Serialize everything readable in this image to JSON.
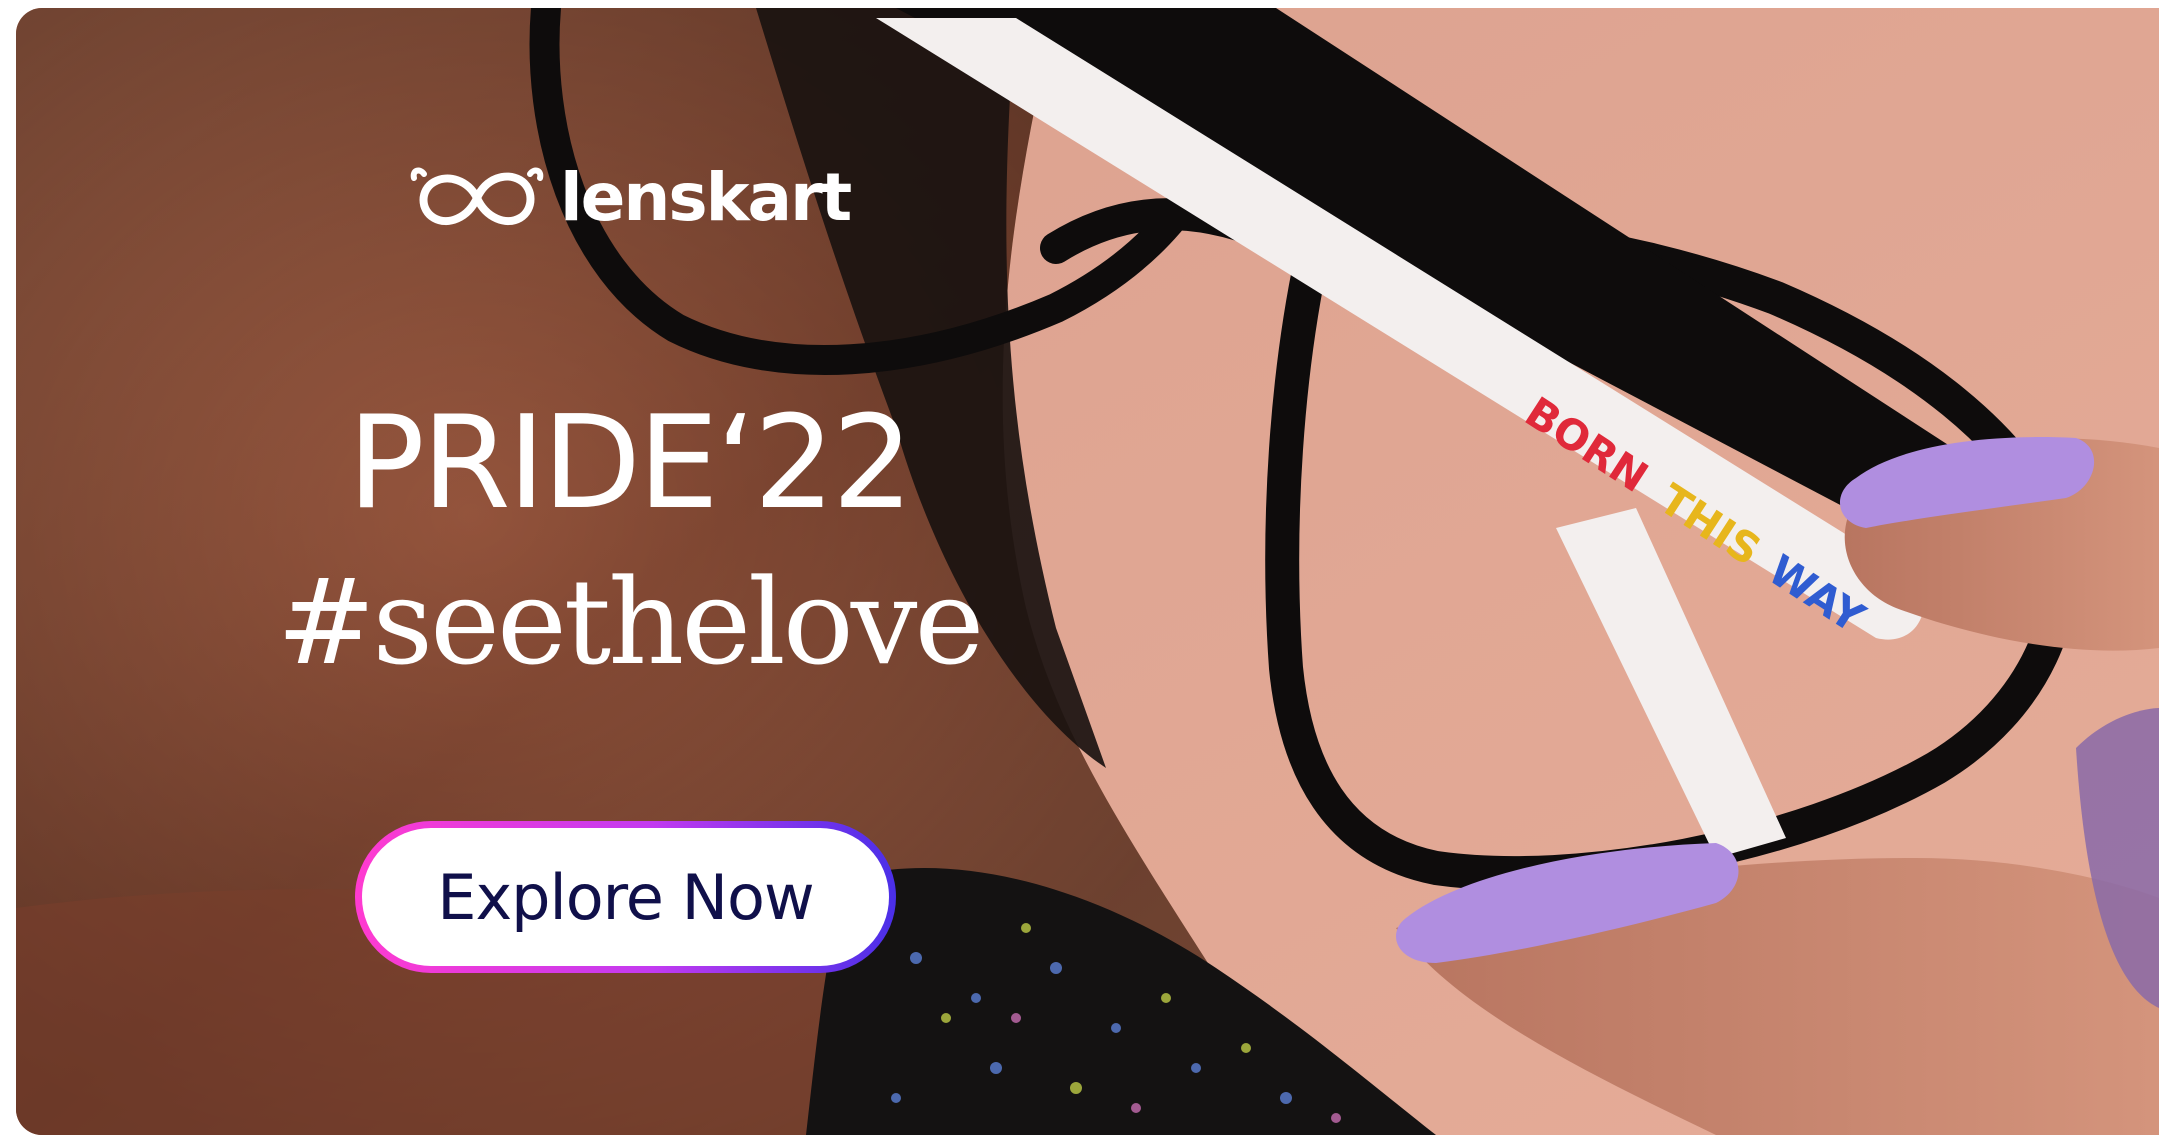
{
  "banner": {
    "brand": "lenskart",
    "headline": "PRIDE‘22",
    "tagline": "#seethelove",
    "cta_label": "Explore Now",
    "temple_text": [
      "BORN",
      "THIS",
      "WAY"
    ],
    "icons": {
      "logo": "lenskart-logo-icon"
    },
    "colors": {
      "background_pink": "#d99a8a",
      "cta_gradient_start": "#ff3bd0",
      "cta_gradient_end": "#4a2fe8",
      "cta_text": "#10104a",
      "nail_lavender": "#b08ee0"
    }
  }
}
